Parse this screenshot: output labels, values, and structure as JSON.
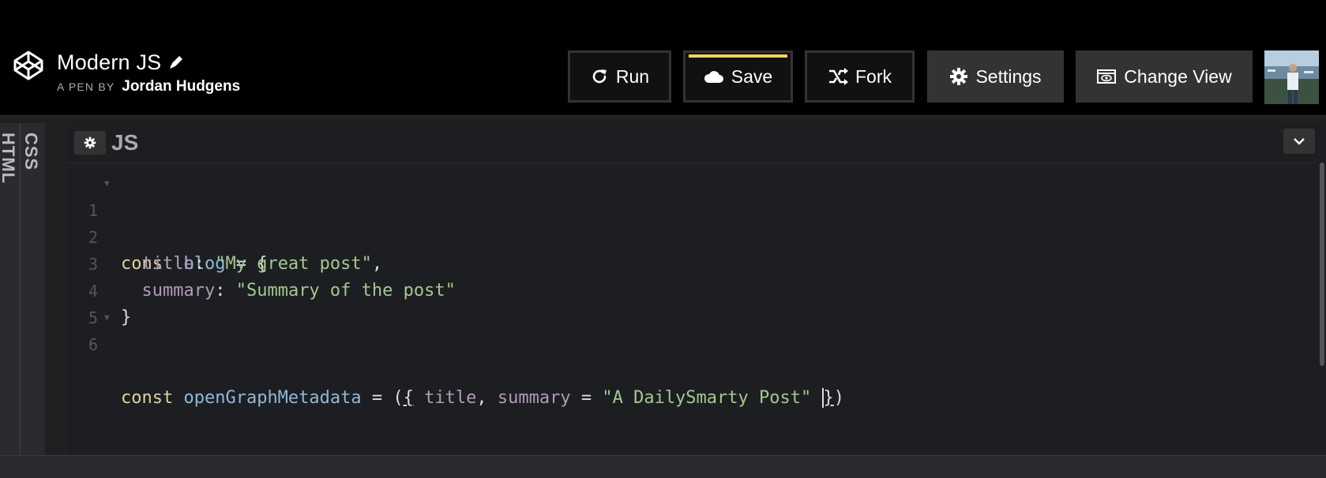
{
  "pen": {
    "title": "Modern JS",
    "byline_prefix": "A PEN BY",
    "author": "Jordan Hudgens"
  },
  "toolbar": {
    "run_label": "Run",
    "save_label": "Save",
    "fork_label": "Fork",
    "settings_label": "Settings",
    "change_view_label": "Change View"
  },
  "side_tabs": {
    "html_label": "HTML",
    "css_label": "CSS"
  },
  "editor": {
    "label": "JS",
    "lines": [
      {
        "num": "1",
        "fold": true
      },
      {
        "num": "2"
      },
      {
        "num": "3"
      },
      {
        "num": "4"
      },
      {
        "num": "5"
      },
      {
        "num": "6",
        "fold": true
      }
    ],
    "tokens": {
      "l1_kw": "const",
      "l1_var": " blog",
      "l1_rest": " = {",
      "l2_prop": "  title",
      "l2_colon": ": ",
      "l2_str": "\"My great post\"",
      "l2_comma": ",",
      "l3_prop": "  summary",
      "l3_colon": ": ",
      "l3_str": "\"Summary of the post\"",
      "l4_close": "}",
      "l6_kw": "const",
      "l6_var": " openGraphMetadata",
      "l6_eq": " = (",
      "l6_open": "{",
      "l6_prop1": " title",
      "l6_comma": ", ",
      "l6_prop2": "summary",
      "l6_eq2": " = ",
      "l6_str": "\"A DailySmarty Post\"",
      "l6_space": " ",
      "l6_close": "}",
      "l6_paren": ")"
    }
  },
  "icons": {
    "logo": "codepen-logo-icon",
    "pencil": "pencil-icon",
    "run": "refresh-icon",
    "save": "cloud-icon",
    "fork": "fork-icon",
    "settings": "gear-icon",
    "change_view": "view-icon",
    "collapse": "chevron-down-icon"
  },
  "colors": {
    "save_accent": "#f5d35c",
    "keyword": "#dcd49a",
    "variable": "#8fb8d8",
    "property": "#b09bb8",
    "string": "#a2c98e"
  }
}
